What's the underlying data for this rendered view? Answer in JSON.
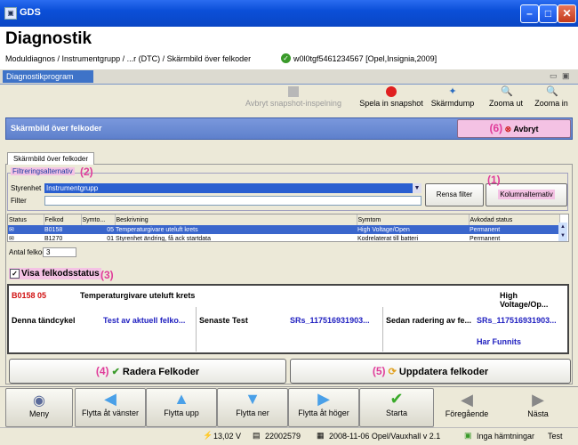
{
  "window": {
    "title": "GDS"
  },
  "header": {
    "title": "Diagnostik",
    "breadcrumb": "Moduldiagnos / Instrumentgrupp / ...r (DTC) / Skärmbild över felkoder",
    "vehicle": "w0l0tgf5461234567 [Opel,Insignia,2009]"
  },
  "program_tab": "Diagnostikprogram",
  "toolbar": {
    "stop_snapshot": "Avbryt snapshot-inspelning",
    "record_snapshot": "Spela in snapshot",
    "screen_dump": "Skärmdump",
    "zoom_out": "Zooma ut",
    "zoom_in": "Zooma in"
  },
  "screen_title": "Skärmbild över felkoder",
  "cancel_label": "Avbryt",
  "annotations": {
    "n1": "(1)",
    "n2": "(2)",
    "n3": "(3)",
    "n4": "(4)",
    "n5": "(5)",
    "n6": "(6)"
  },
  "subtab": "Skärmbild över felkoder",
  "filter": {
    "group_label": "Filtreringsalternativ",
    "controller_label": "Styrenhet",
    "controller_value": "Instrumentgrupp",
    "filter_label": "Filter",
    "clear_button": "Rensa filter",
    "columns_button": "Kolumnalternativ"
  },
  "table": {
    "headers": [
      "Status",
      "Felkod",
      "Symto...",
      "Beskrivning",
      "Symtom",
      "Avkodad status"
    ],
    "rows": [
      [
        "",
        "B0158",
        "05",
        "Temperaturgivare uteluft krets",
        "High Voltage/Open",
        "Permanent"
      ],
      [
        "",
        "B1270",
        "01",
        "Styrenhet ändring, få ack startdata",
        "Kodrelaterat till batteri",
        "Permanent"
      ]
    ]
  },
  "count": {
    "label": "Antal felkoder",
    "value": "3"
  },
  "show_status": {
    "label": "Visa felkodsstatus"
  },
  "detail": {
    "code": "B0158 05",
    "description": "Temperaturgivare uteluft krets",
    "symptom": "High Voltage/Op...",
    "this_cycle_label": "Denna tändcykel",
    "this_cycle_value": "Test av aktuell felko...",
    "last_test_label": "Senaste Test",
    "last_test_value": "SRs_117516931903...",
    "since_clear_label": "Sedan radering av fe...",
    "since_clear_value": "SRs_117516931903...",
    "found": "Har Funnits"
  },
  "actions": {
    "clear": "Radera Felkoder",
    "update": "Uppdatera felkoder"
  },
  "nav": {
    "menu": "Meny",
    "left": "Flytta åt vänster",
    "up": "Flytta upp",
    "down": "Flytta ner",
    "right": "Flytta åt höger",
    "start": "Starta",
    "previous": "Föregående",
    "next": "Nästa"
  },
  "status": {
    "voltage": "13,02 V",
    "id": "22002579",
    "version": "2008-11-06 Opel/Vauxhall v 2.1",
    "downloads": "Inga hämtningar",
    "mode": "Test"
  }
}
